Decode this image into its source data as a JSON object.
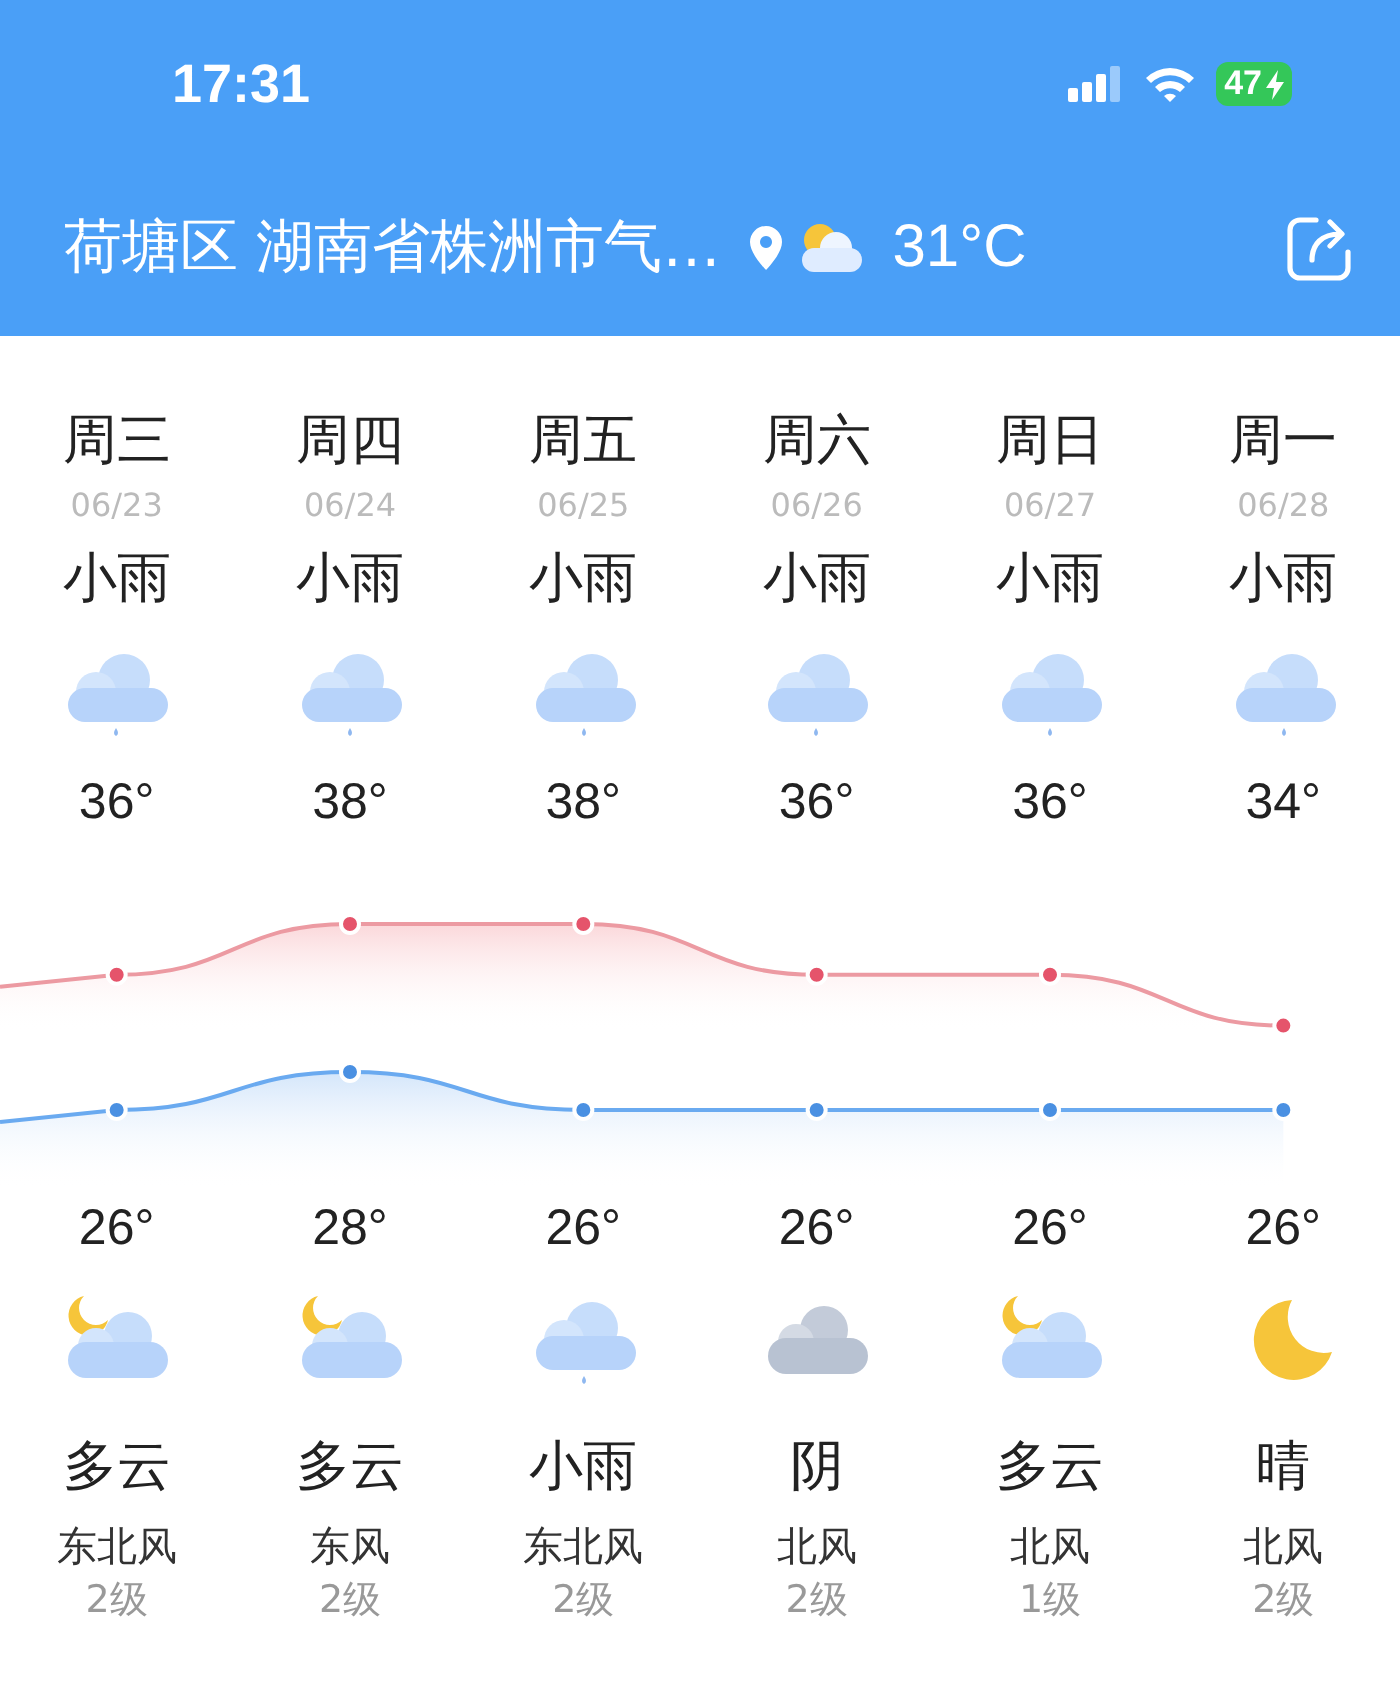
{
  "status_bar": {
    "time": "17:31",
    "battery": "47"
  },
  "header": {
    "title": "荷塘区 湖南省株洲市气…",
    "temperature": "31°C"
  },
  "days": [
    {
      "weekday": "周三",
      "date": "06/23",
      "day_weather": "小雨",
      "day_icon": {
        "kind": "rain"
      },
      "high": "36°",
      "low": "26°",
      "night_icon": {
        "kind": "cloudy-night"
      },
      "night_weather": "多云",
      "wind": "东北风",
      "wind_level": "2级"
    },
    {
      "weekday": "周四",
      "date": "06/24",
      "day_weather": "小雨",
      "day_icon": {
        "kind": "rain"
      },
      "high": "38°",
      "low": "28°",
      "night_icon": {
        "kind": "cloudy-night"
      },
      "night_weather": "多云",
      "wind": "东风",
      "wind_level": "2级"
    },
    {
      "weekday": "周五",
      "date": "06/25",
      "day_weather": "小雨",
      "day_icon": {
        "kind": "rain"
      },
      "high": "38°",
      "low": "26°",
      "night_icon": {
        "kind": "rain"
      },
      "night_weather": "小雨",
      "wind": "东北风",
      "wind_level": "2级"
    },
    {
      "weekday": "周六",
      "date": "06/26",
      "day_weather": "小雨",
      "day_icon": {
        "kind": "rain"
      },
      "high": "36°",
      "low": "26°",
      "night_icon": {
        "kind": "overcast"
      },
      "night_weather": "阴",
      "wind": "北风",
      "wind_level": "2级"
    },
    {
      "weekday": "周日",
      "date": "06/27",
      "day_weather": "小雨",
      "day_icon": {
        "kind": "rain"
      },
      "high": "36°",
      "low": "26°",
      "night_icon": {
        "kind": "cloudy-night"
      },
      "night_weather": "多云",
      "wind": "北风",
      "wind_level": "1级"
    },
    {
      "weekday": "周一",
      "date": "06/28",
      "day_weather": "小雨",
      "day_icon": {
        "kind": "rain"
      },
      "high": "34°",
      "low": "26°",
      "night_icon": {
        "kind": "clear-night"
      },
      "night_weather": "晴",
      "wind": "北风",
      "wind_level": "2级"
    }
  ]
}
